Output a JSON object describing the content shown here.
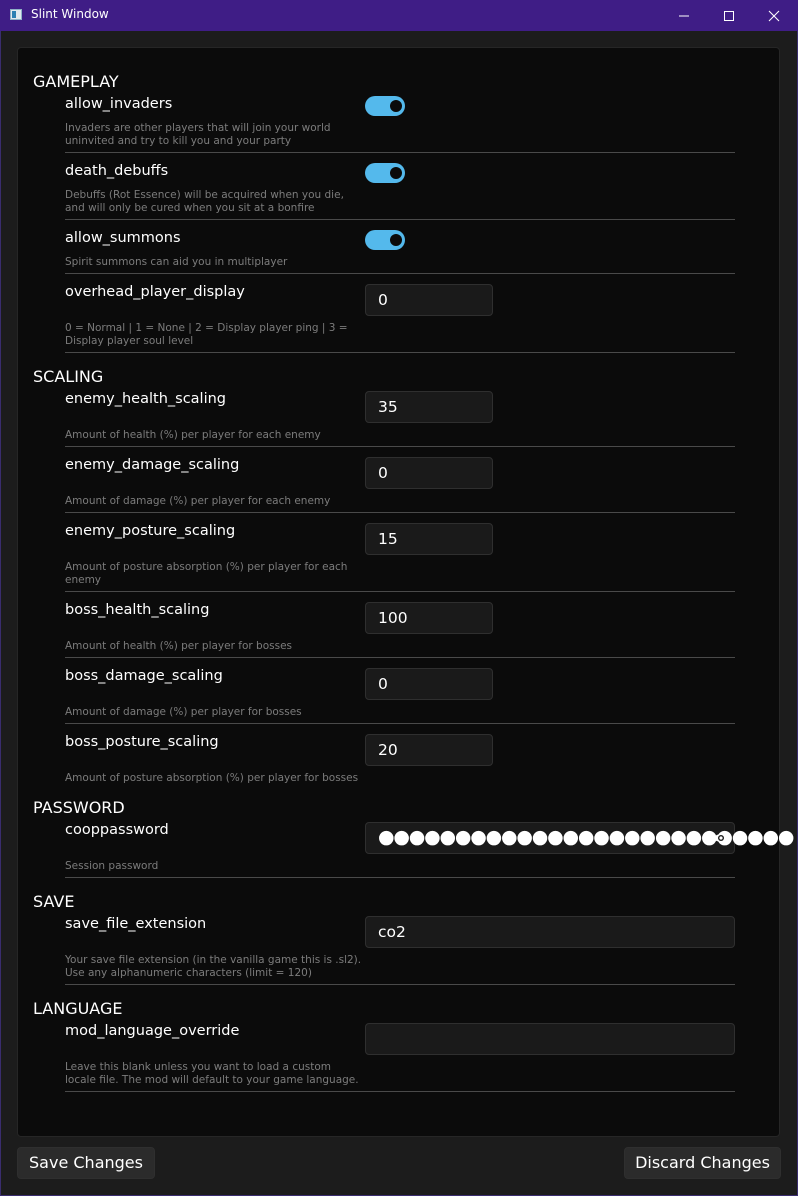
{
  "window": {
    "title": "Slint Window"
  },
  "sections": {
    "gameplay": "GAMEPLAY",
    "scaling": "SCALING",
    "password": "PASSWORD",
    "save": "SAVE",
    "language": "LANGUAGE"
  },
  "settings": {
    "allow_invaders": {
      "name": "allow_invaders",
      "enabled": true,
      "desc1": "Invaders are other players that will join your world",
      "desc2": "uninvited and try to kill you and your party"
    },
    "death_debuffs": {
      "name": "death_debuffs",
      "enabled": true,
      "desc1": "Debuffs (Rot Essence) will be acquired when you die,",
      "desc2": "and will only be cured when you sit at a bonfire"
    },
    "allow_summons": {
      "name": "allow_summons",
      "enabled": true,
      "desc1": "Spirit summons can aid you in multiplayer"
    },
    "overhead_player_display": {
      "name": "overhead_player_display",
      "value": "0",
      "desc1": "0 = Normal | 1 = None | 2 = Display player ping | 3 =",
      "desc2": "Display player soul level"
    },
    "enemy_health_scaling": {
      "name": "enemy_health_scaling",
      "value": "35",
      "desc1": "Amount of health (%) per player for each enemy"
    },
    "enemy_damage_scaling": {
      "name": "enemy_damage_scaling",
      "value": "0",
      "desc1": "Amount of damage (%) per player for each enemy"
    },
    "enemy_posture_scaling": {
      "name": "enemy_posture_scaling",
      "value": "15",
      "desc1": "Amount of posture absorption (%) per player for each",
      "desc2": "enemy"
    },
    "boss_health_scaling": {
      "name": "boss_health_scaling",
      "value": "100",
      "desc1": "Amount of health (%) per player for bosses"
    },
    "boss_damage_scaling": {
      "name": "boss_damage_scaling",
      "value": "0",
      "desc1": "Amount of damage (%) per player for bosses"
    },
    "boss_posture_scaling": {
      "name": "boss_posture_scaling",
      "value": "20",
      "desc1": "Amount of posture absorption (%) per player for bosses"
    },
    "cooppassword": {
      "name": "cooppassword",
      "masked_value": "●●●●●●●●●●●●●●●●●●●●●●●●●●●",
      "desc1": "Session password"
    },
    "save_file_extension": {
      "name": "save_file_extension",
      "value": "co2",
      "desc1": "Your save file extension (in the vanilla game this is .sl2).",
      "desc2": "Use any alphanumeric characters (limit = 120)"
    },
    "mod_language_override": {
      "name": "mod_language_override",
      "value": "",
      "desc1": "Leave this blank unless you want to load a custom",
      "desc2": "locale file. The mod will default to your game language."
    }
  },
  "buttons": {
    "save": "Save Changes",
    "discard": "Discard Changes"
  },
  "colors": {
    "titlebar": "#3f1d86",
    "toggle_on": "#54b9ec",
    "panel_bg": "#0b0b0b",
    "window_bg": "#1c1c1c"
  },
  "icons": {
    "app": "app-icon",
    "minimize": "minimize-icon",
    "maximize": "maximize-icon",
    "close": "close-icon",
    "reveal_password": "eye-icon"
  }
}
